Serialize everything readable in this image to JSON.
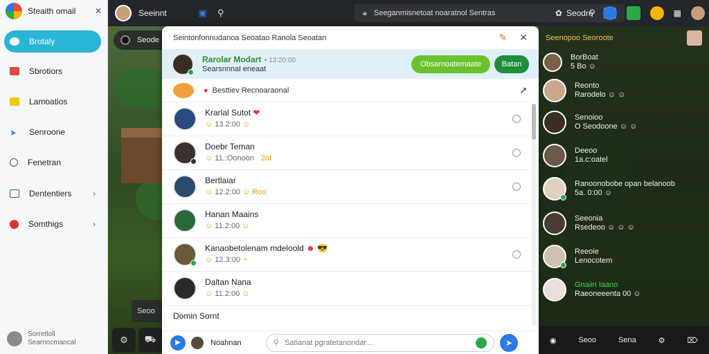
{
  "sidebar": {
    "title": "Steaith omail",
    "close": "✕",
    "items": [
      {
        "label": "Brotaly",
        "color": "#ffffff"
      },
      {
        "label": "Sbrotiors",
        "color": "#e04a3a"
      },
      {
        "label": "Lamoatios",
        "color": "#f5c400"
      },
      {
        "label": "Senroone",
        "color": "#2c7be5"
      },
      {
        "label": "Fenetran",
        "color": "#666666"
      },
      {
        "label": "Dententiers",
        "color": "#2c5aa0"
      },
      {
        "label": "Somthigs",
        "color": "#e03030"
      }
    ],
    "footer": {
      "line1": "Sorretloll",
      "line2": "Searnocmancal"
    }
  },
  "topbar": {
    "title": "Seeinnt",
    "address": "Seeganmisnetoat noaratnol Sentras",
    "right_label": "Seodre"
  },
  "game": {
    "sub_label": "Seode",
    "left_btn": "Seoo",
    "bottom_icons": [
      "⚙",
      "⛟"
    ]
  },
  "modal": {
    "title": "Seintonfonnudanoa Seoatao Ranola Seoatan",
    "selected": {
      "name": "Rarolar Modart",
      "time": "• 13:20:00",
      "sub": "Searsnnnal eneaat",
      "primary": "Obsarnoatemaate",
      "secondary": "Batan"
    },
    "favorite": "Besttiev Recnoaraonal",
    "rows": [
      {
        "name": "Krarlal Sutot",
        "extra": "❤",
        "sub": "13.2:00",
        "emoji": "☺",
        "avatar": "#2a4a80"
      },
      {
        "name": "Doebr Teman",
        "extra": "",
        "sub": "11.:Oonoon",
        "emoji": "· 2ot",
        "avatar": "#3a3030"
      },
      {
        "name": "Bertlaiar",
        "extra": "",
        "sub": "12.2:00",
        "emoji": "☺ Roo",
        "avatar": "#2a4a6a"
      },
      {
        "name": "Hanan Maains",
        "extra": "",
        "sub": "11.2:00",
        "emoji": "☺",
        "avatar": "#2a6a3a"
      },
      {
        "name": "Kanaobetolenam mdeloold",
        "extra": "☻ 😎",
        "sub": "12.3:00",
        "emoji": "◔",
        "avatar": "#6a5a3a"
      },
      {
        "name": "Daltan Nana",
        "extra": "",
        "sub": "11.2:00",
        "emoji": "☺",
        "avatar": "#2a2a2a"
      }
    ],
    "partial_row": "Domin Sornt",
    "footer": {
      "name": "Noahnan",
      "placeholder": "Satianat pgratetanondar..."
    }
  },
  "right_panel": {
    "header": "Seenopoo Seoroote",
    "items": [
      {
        "name": "BorBoat",
        "sub": "5 Bo ☺",
        "color": "#eeeeee",
        "green": false
      },
      {
        "name": "Reonto",
        "sub": "Rarodelo ☺ ☺",
        "color": "#eeeeee",
        "green": false
      },
      {
        "name": "Senoioo",
        "sub": "O Seodoone ☺ ☺",
        "color": "#eeeeee",
        "green": false
      },
      {
        "name": "Deeoo",
        "sub": "1a.c:oatel",
        "color": "#eeeeee",
        "green": false
      },
      {
        "name": "Ranoonobobe opan belanoob",
        "sub": "5a. 0:00 ☺",
        "color": "#eeeeee",
        "green": false
      },
      {
        "name": "Seeonia",
        "sub": "Rsedeoo ☺ ☺ ☺",
        "color": "#eeeeee",
        "green": false
      },
      {
        "name": "Reeoie",
        "sub": "Lenocotem",
        "color": "#eeeeee",
        "green": false
      },
      {
        "name": "Gnaiin Iaano",
        "sub": "Raeoneeenta 00 ☺",
        "color": "#3ad04a",
        "green": true
      }
    ],
    "bottom": [
      "◉",
      "Seoo",
      "Sena",
      "⚙",
      "⌦"
    ]
  }
}
